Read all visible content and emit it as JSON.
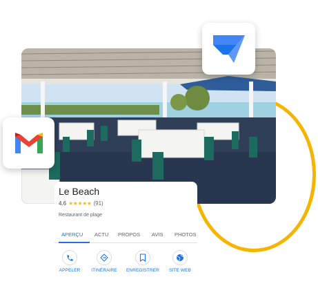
{
  "place": {
    "name": "Le Beach",
    "rating": "4.6",
    "stars": "★★★★★",
    "review_count": "(91)",
    "category": "Restaurant de plage"
  },
  "tabs": [
    {
      "label": "APERÇU"
    },
    {
      "label": "ACTU"
    },
    {
      "label": "PROPOS"
    },
    {
      "label": "AVIS"
    },
    {
      "label": "PHOTOS"
    }
  ],
  "actions": [
    {
      "label": "APPELER",
      "icon": "phone-icon"
    },
    {
      "label": "ITINÉRAIRE",
      "icon": "directions-icon"
    },
    {
      "label": "ENREGISTRER",
      "icon": "bookmark-icon"
    },
    {
      "label": "SITE WEB",
      "icon": "globe-icon"
    }
  ],
  "apps": {
    "gmail_icon": "gmail-logo",
    "appsheet_icon": "appsheet-logo"
  },
  "colors": {
    "accent_ring": "#f4b400",
    "active_tab": "#1a73e8",
    "star": "#fbbc04",
    "appsheet_blue": "#4285f4"
  }
}
